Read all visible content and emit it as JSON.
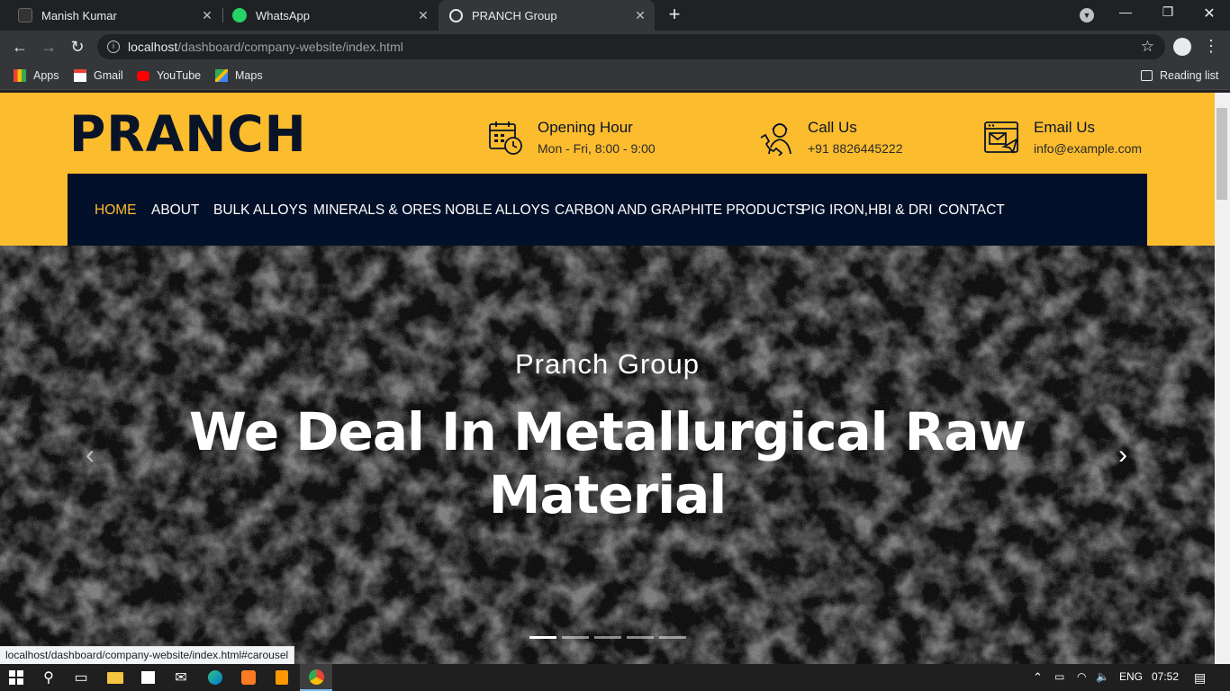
{
  "browser": {
    "tabs": [
      {
        "title": "Manish Kumar",
        "icon": "generic-site-icon"
      },
      {
        "title": "WhatsApp",
        "icon": "whatsapp-icon"
      },
      {
        "title": "PRANCH Group",
        "icon": "globe-icon",
        "active": true
      }
    ],
    "url_host": "localhost",
    "url_path": "/dashboard/company-website/index.html",
    "bookmarks": [
      {
        "label": "Apps",
        "icon": "apps-grid-icon"
      },
      {
        "label": "Gmail",
        "icon": "gmail-icon"
      },
      {
        "label": "YouTube",
        "icon": "youtube-icon"
      },
      {
        "label": "Maps",
        "icon": "maps-icon"
      }
    ],
    "reading_list": "Reading list",
    "status_url": "localhost/dashboard/company-website/index.html#carousel"
  },
  "site": {
    "logo": "PRANCH",
    "info": [
      {
        "heading": "Opening Hour",
        "value": "Mon - Fri, 8:00 - 9:00",
        "icon": "calendar-clock-icon"
      },
      {
        "heading": "Call Us",
        "value": "+91 8826445222",
        "icon": "support-agent-icon"
      },
      {
        "heading": "Email Us",
        "value": "info@example.com",
        "icon": "email-web-icon"
      }
    ],
    "nav": [
      {
        "label": "HOME",
        "active": true
      },
      {
        "label": "ABOUT"
      },
      {
        "label": "BULK ALLOYS"
      },
      {
        "label": "MINERALS & ORES"
      },
      {
        "label": "NOBLE ALLOYS"
      },
      {
        "label": "CARBON AND GRAPHITE PRODUCTS"
      },
      {
        "label": "PIG IRON,HBI & DRI"
      },
      {
        "label": "CONTACT"
      }
    ],
    "hero": {
      "subtitle": "Pranch Group",
      "title": "We Deal In Metallurgical Raw Material",
      "indicators": 5,
      "active_indicator": 0
    }
  },
  "taskbar": {
    "language": "ENG",
    "time": "07:52"
  },
  "colors": {
    "brand_yellow": "#fbbc2e",
    "nav_dark": "#03102a",
    "logo_navy": "#0a1428"
  }
}
